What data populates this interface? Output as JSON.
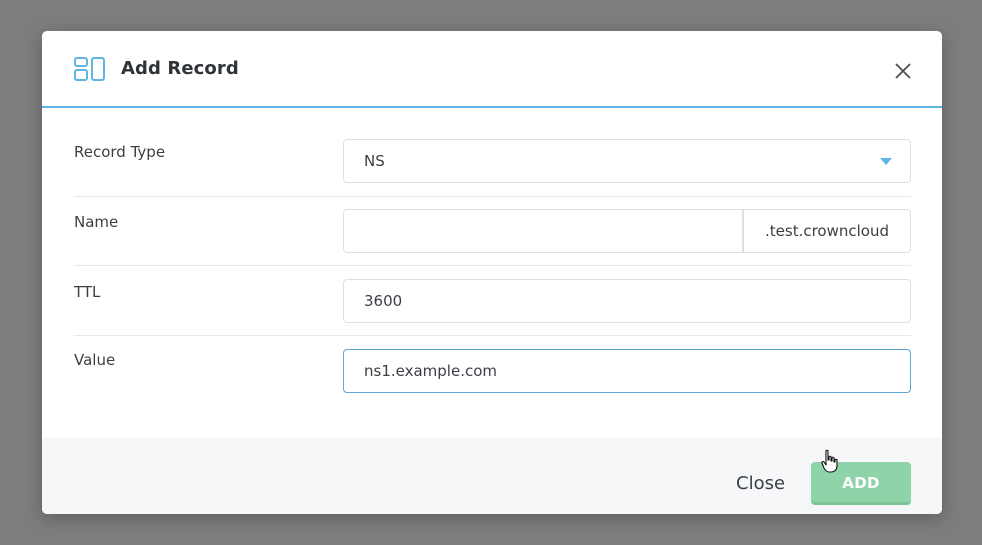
{
  "dialog": {
    "title": "Add Record",
    "header_icon": "dns-records-icon",
    "close_icon": "close-icon"
  },
  "form": {
    "record_type": {
      "label": "Record Type",
      "value": "NS",
      "icon": "caret-down-icon"
    },
    "name": {
      "label": "Name",
      "value": "",
      "suffix": ".test.crowncloud"
    },
    "ttl": {
      "label": "TTL",
      "value": "3600"
    },
    "value": {
      "label": "Value",
      "value": "ns1.example.com"
    }
  },
  "footer": {
    "close_label": "Close",
    "add_label": "ADD"
  },
  "colors": {
    "accent": "#5eb6e4",
    "add_button": "#8fd3a8",
    "backdrop": "#7d7d7d"
  }
}
